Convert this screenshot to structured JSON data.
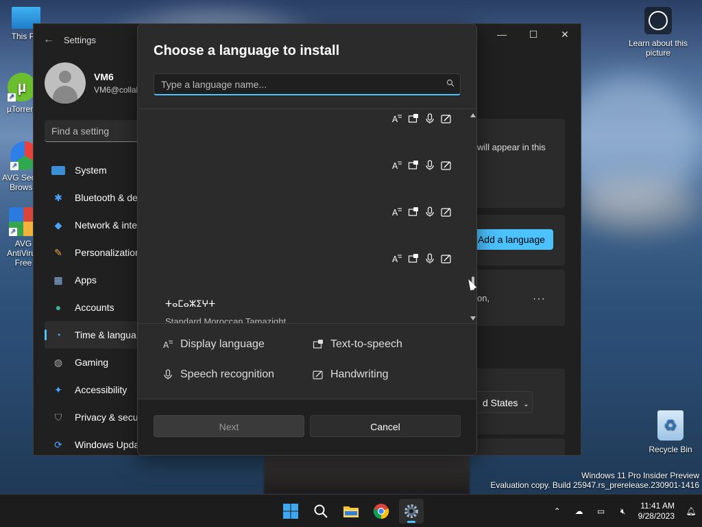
{
  "desktop": {
    "icons": [
      {
        "label": "This PC"
      },
      {
        "label": "µTorrent"
      },
      {
        "label": "AVG Secure Browser"
      },
      {
        "label": "AVG AntiVirus Free"
      }
    ],
    "learn_label": "Learn about this picture",
    "recycle_label": "Recycle Bin",
    "watermark_line1": "Windows 11 Pro Insider Preview",
    "watermark_line2": "Evaluation copy. Build 25947.rs_prerelease.230901-1416"
  },
  "settings": {
    "title": "Settings",
    "user_name": "VM6",
    "user_email": "VM6@collal",
    "find_placeholder": "Find a setting",
    "nav": [
      {
        "label": "System"
      },
      {
        "label": "Bluetooth & de"
      },
      {
        "label": "Network & inte"
      },
      {
        "label": "Personalization"
      },
      {
        "label": "Apps"
      },
      {
        "label": "Accounts"
      },
      {
        "label": "Time & langua"
      },
      {
        "label": "Gaming"
      },
      {
        "label": "Accessibility"
      },
      {
        "label": "Privacy & secu"
      },
      {
        "label": "Windows Upda"
      }
    ],
    "active_nav": "Time & langua",
    "right_text_1": "will appear in this",
    "add_language": "Add a language",
    "right_text_2": "on,",
    "more": "···",
    "region_value": "d States"
  },
  "dialog": {
    "title": "Choose a language to install",
    "search_placeholder": "Type a language name...",
    "visible_language": {
      "native": "ⵜⴰⵎⴰⵣⵉⵖⵜ",
      "english": "Standard Moroccan Tamazight"
    },
    "legend": {
      "display": "Display language",
      "tts": "Text-to-speech",
      "speech": "Speech recognition",
      "handwriting": "Handwriting"
    },
    "next_label": "Next",
    "cancel_label": "Cancel"
  },
  "taskbar": {
    "time": "11:41 AM",
    "date": "9/28/2023"
  },
  "colors": {
    "accent": "#4cc2ff",
    "dialog_bg": "#2b2b2b",
    "window_bg": "#202020"
  }
}
